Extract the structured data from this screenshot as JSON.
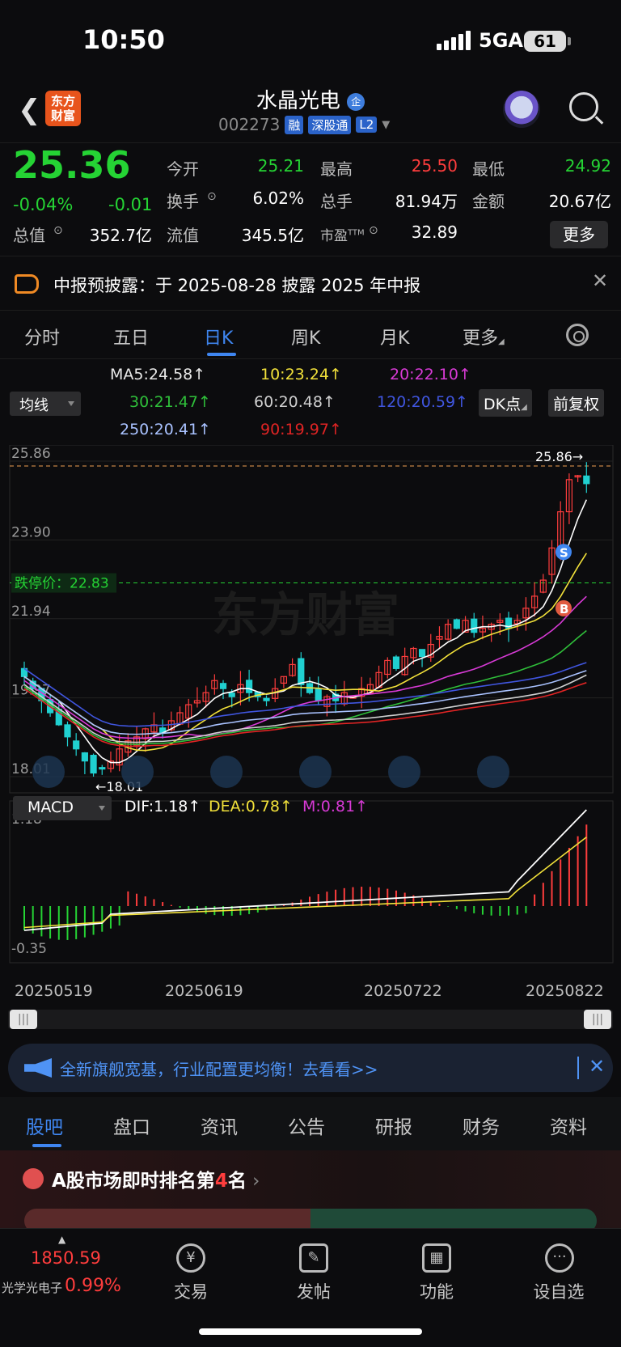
{
  "status_bar": {
    "time": "10:50",
    "network": "5GA",
    "battery": "61"
  },
  "header": {
    "logo": "东方财富",
    "stock_name": "水晶光电",
    "badge_qy": "企",
    "code": "002273",
    "tags": [
      "融",
      "深股通",
      "L2"
    ]
  },
  "quote": {
    "price": "25.36",
    "change_pct": "-0.04%",
    "change": "-0.01",
    "open_label": "今开",
    "open": "25.21",
    "high_label": "最高",
    "high": "25.50",
    "low_label": "最低",
    "low": "24.92",
    "turnover_label": "换手",
    "turnover": "6.02%",
    "volume_label": "总手",
    "volume": "81.94万",
    "amount_label": "金额",
    "amount": "20.67亿",
    "mktcap_label": "总值",
    "mktcap": "352.7亿",
    "float_label": "流值",
    "float": "345.5亿",
    "pe_label": "市盈",
    "pe_sup": "TTM",
    "pe": "32.89",
    "more_btn": "更多"
  },
  "notice": {
    "text": "中报预披露：于 2025-08-28 披露 2025 年中报"
  },
  "tabs": [
    "分时",
    "五日",
    "日K",
    "周K",
    "月K",
    "更多"
  ],
  "active_tab": "日K",
  "ma_legend": {
    "ma5": "MA5:24.58↑",
    "ma10": "10:23.24↑",
    "ma20": "20:22.10↑",
    "ma30": "30:21.47↑",
    "ma60": "60:20.48↑",
    "ma120": "120:20.59↑",
    "ma250": "250:20.41↑",
    "ma90": "90:19.97↑"
  },
  "indicator_select": "均线",
  "dk_btn": "DK点",
  "adj_btn": "前复权",
  "chart_data": {
    "type": "candlestick",
    "price_axis": [
      "25.86",
      "23.90",
      "21.94",
      "19.97",
      "18.01"
    ],
    "ylim": [
      18.01,
      25.86
    ],
    "limit_down_label": "跌停价：22.83",
    "limit_down": 22.83,
    "max_marker": "25.86→",
    "min_marker": "←18.01",
    "watermark": "东方财富",
    "signals": [
      "S",
      "B"
    ],
    "x_dates": [
      "20250519",
      "20250619",
      "20250722",
      "20250822"
    ],
    "macd": {
      "label": "MACD",
      "dif": "DIF:1.18↑",
      "dea": "DEA:0.78↑",
      "m": "M:0.81↑",
      "axis": [
        "1.18",
        "-0.35"
      ]
    }
  },
  "ad": {
    "text": "全新旗舰宽基，行业配置更均衡！去看看>>"
  },
  "bottom_tabs": [
    "股吧",
    "盘口",
    "资讯",
    "公告",
    "研报",
    "财务",
    "资料"
  ],
  "rank": {
    "prefix": "A股市场即时排名第",
    "num": "4",
    "suffix": "名"
  },
  "bottom_nav": {
    "index_value": "1850.59",
    "index_name": "光学光电子",
    "index_pct": "0.99%",
    "items": [
      "交易",
      "发帖",
      "功能",
      "设自选"
    ]
  },
  "colors": {
    "up": "#ff3d3d",
    "down": "#25d334",
    "accent": "#3f86f0"
  }
}
